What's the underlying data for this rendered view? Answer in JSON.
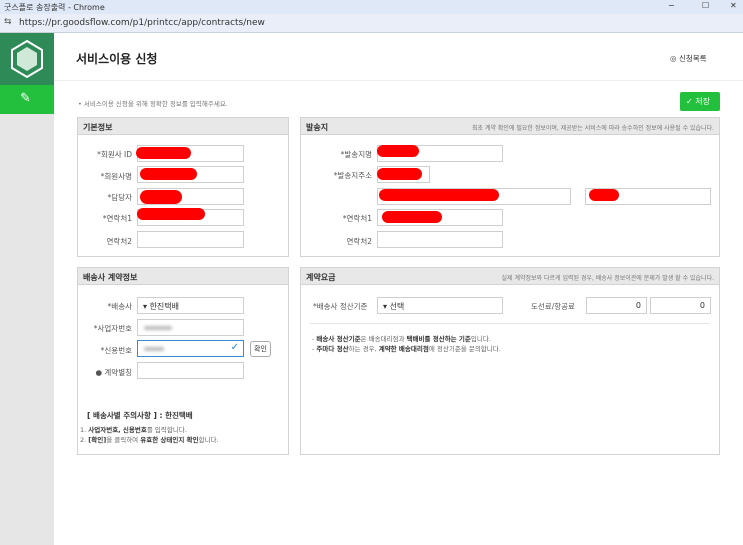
{
  "window": {
    "title": "굿스플로 송장출력 - Chrome",
    "url": "https://pr.goodsflow.com/p1/printcc/app/contracts/new"
  },
  "header": {
    "title": "서비스이용 신청",
    "list_link": "신청목록"
  },
  "notice": "서비스이용 신청을 위해 정확한 정보를 입력해주세요.",
  "save_label": "저장",
  "basic": {
    "title": "기본정보",
    "labels": [
      "*회원사 ID",
      "*회원사명",
      "*담당자",
      "*연락처1",
      "연락처2"
    ]
  },
  "sender": {
    "title": "발송지",
    "note": "최초 계약 확인에 필요한 정보이며, 제공받는 서비스에 따라 송수하인 정보에 사용될 수 있습니다.",
    "labels": [
      "*발송지명",
      "*발송지주소",
      "*연락처1",
      "연락처2"
    ]
  },
  "carrier": {
    "title": "배송사 계약정보",
    "labels": [
      "*배송사",
      "*사업자번호",
      "*신용번호",
      "계약별칭"
    ],
    "carrier_value": "한진택배",
    "confirm_label": "확인",
    "caution_title": "[ 배송사별 주의사항 ] : 한진택배",
    "caution": [
      [
        "1. ",
        "사업자번호, 신용번호",
        "를 입력합니다."
      ],
      [
        "2. ",
        "[확인]",
        "을 클릭하여 ",
        "유효한 상태인지 확인",
        "합니다."
      ]
    ]
  },
  "fee": {
    "title": "계약요금",
    "note": "실제 계약정보와 다르게 입력된 경우, 배송사 정보이관에 문제가 발생 할 수 있습니다.",
    "basis_label": "*배송사 정산기준",
    "basis_value": "선택",
    "island_label": "도선료/항공료",
    "island_values": [
      "0",
      "0"
    ],
    "notes": [
      [
        "- ",
        "배송사 정산기준",
        "은 배송대리점과 ",
        "택배비를 정산하는 기준",
        "입니다."
      ],
      [
        "- ",
        "주마다 정산",
        "하는 경우, ",
        "계약한 배송대리점",
        "에 정산기준을 문의합니다."
      ]
    ]
  },
  "colors": {
    "brand_dark": "#2e8b57",
    "brand_green": "#22c03c",
    "redaction": "#ff0000"
  }
}
